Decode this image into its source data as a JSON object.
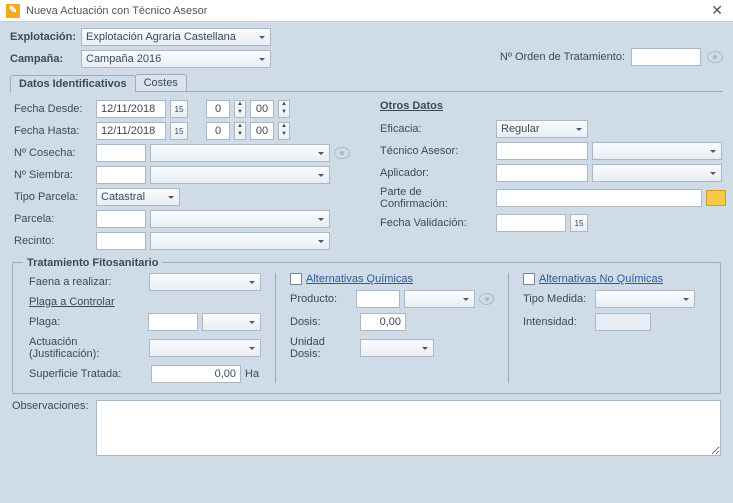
{
  "title": "Nueva Actuación con Técnico Asesor",
  "header": {
    "explotacion_lbl": "Explotación:",
    "explotacion_val": "Explotación Agraria Castellana",
    "campana_lbl": "Campaña:",
    "campana_val": "Campaña 2016",
    "orden_lbl": "Nº Orden de Tratamiento:",
    "orden_val": ""
  },
  "tabs": {
    "t1": "Datos Identificativos",
    "t2": "Costes"
  },
  "left": {
    "fdesde_lbl": "Fecha Desde:",
    "fdesde": "12/11/2018",
    "fdesde_h": "0",
    "fdesde_m": "00",
    "fhasta_lbl": "Fecha Hasta:",
    "fhasta": "12/11/2018",
    "fhasta_h": "0",
    "fhasta_m": "00",
    "cosecha_lbl": "Nº Cosecha:",
    "cosecha": "",
    "cosecha2": "",
    "siembra_lbl": "Nº Siembra:",
    "siembra": "",
    "siembra2": "",
    "tipop_lbl": "Tipo Parcela:",
    "tipop": "Catastral",
    "parcela_lbl": "Parcela:",
    "parcela": "",
    "parcela2": "",
    "recinto_lbl": "Recinto:",
    "recinto": "",
    "recinto2": ""
  },
  "right": {
    "hdr": "Otros Datos",
    "eficacia_lbl": "Eficacia:",
    "eficacia": "Regular",
    "tecnico_lbl": "Técnico Asesor:",
    "tecnico": "",
    "tecnico2": "",
    "aplicador_lbl": "Aplicador:",
    "aplicador": "",
    "aplicador2": "",
    "parte_lbl": "Parte de Confirmación:",
    "parte": "",
    "fvalid_lbl": "Fecha Validación:",
    "fvalid": ""
  },
  "fito": {
    "legend": "Tratamiento Fitosanitario",
    "faena_lbl": "Faena a realizar:",
    "faena": "",
    "plaga_hdr": "Plaga a Controlar",
    "plaga_lbl": "Plaga:",
    "plaga": "",
    "plaga2": "",
    "actua_lbl": "Actuación (Justificación):",
    "actua": "",
    "sup_lbl": "Superficie Tratada:",
    "sup": "0,00",
    "sup_u": "Ha",
    "altq": "Alternativas Químicas",
    "prod_lbl": "Producto:",
    "prod": "",
    "prod2": "",
    "dosis_lbl": "Dosis:",
    "dosis": "0,00",
    "udosis_lbl": "Unidad Dosis:",
    "udosis": "",
    "altnq": "Alternativas No Químicas",
    "tmed_lbl": "Tipo Medida:",
    "tmed": "",
    "int_lbl": "Intensidad:",
    "int": ""
  },
  "obs_lbl": "Observaciones:"
}
